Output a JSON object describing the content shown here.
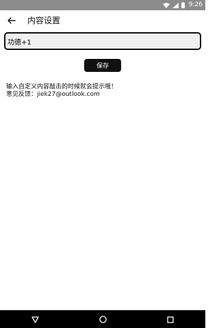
{
  "status_bar": {
    "time": "9:26",
    "icons": [
      "wifi-icon",
      "signal-icon",
      "battery-icon"
    ]
  },
  "app_bar": {
    "title": "内容设置",
    "back_icon": "arrow-left-icon"
  },
  "input": {
    "value": "功德+1",
    "placeholder": ""
  },
  "save_button": {
    "label": "保存"
  },
  "hint": {
    "line1": "输入自定义内容敲击的时候就会提示哦！",
    "line2": "意见反馈：jiek27@outlook.com"
  },
  "nav_bar": {
    "icons": [
      "back-triangle-icon",
      "home-circle-icon",
      "recents-square-icon"
    ]
  },
  "colors": {
    "status_bar_bg": "#8c8c8c",
    "nav_bar_bg": "#000000",
    "button_bg": "#111111",
    "input_bg": "#f0f0f0"
  }
}
